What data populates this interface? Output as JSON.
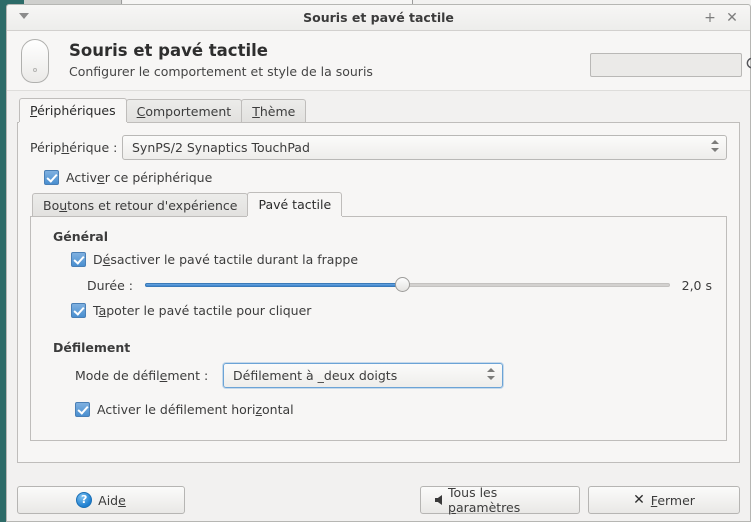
{
  "window": {
    "title": "Souris et pavé tactile",
    "menu_icon": "chevron-down-icon",
    "maximize_label": "+",
    "close_label": "✕"
  },
  "header": {
    "icon": "mouse-icon",
    "title": "Souris et pavé tactile",
    "subtitle": "Configurer le comportement et style de la souris",
    "search": {
      "value": "",
      "placeholder": "",
      "icon": "search-icon"
    }
  },
  "tabs": [
    {
      "label": "Périphériques",
      "mnemonic": "P",
      "active": true
    },
    {
      "label": "Comportement",
      "mnemonic": "C",
      "active": false
    },
    {
      "label": "Thème",
      "mnemonic": "T",
      "active": false
    }
  ],
  "device": {
    "label_pre": "Périp",
    "label_mn": "h",
    "label_post": "érique :",
    "value": "SynPS/2 Synaptics TouchPad",
    "enable_checkbox": {
      "pre": "Activ",
      "mn": "e",
      "post": "r ce périphérique",
      "checked": true
    }
  },
  "inner_tabs": [
    {
      "pre": "Bo",
      "mn": "u",
      "post": "tons et retour d'expérience",
      "active": false
    },
    {
      "pre": "",
      "mn": "",
      "post": "Pavé tactile",
      "active": true
    }
  ],
  "general": {
    "section_title": "Général",
    "disable_while_typing": {
      "pre": "D",
      "mn": "é",
      "post": "sactiver le pavé tactile durant la frappe",
      "checked": true
    },
    "duration": {
      "label": "Durée :",
      "value_text": "2,0 s",
      "value": 2.0,
      "min": 0.0,
      "max": 3.6,
      "percent": 49
    },
    "tap_to_click": {
      "pre": "T",
      "mn": "a",
      "post": "poter le pavé tactile pour cliquer",
      "checked": true
    }
  },
  "scrolling": {
    "section_title": "Défilement",
    "mode_label_pre": "Mode de défil",
    "mode_label_mn": "e",
    "mode_label_post": "ment :",
    "mode_value": "Défilement à _deux doigts",
    "horizontal": {
      "pre": "Activer le défilement hori",
      "mn": "z",
      "post": "ontal",
      "checked": true
    }
  },
  "actions": {
    "help": {
      "pre": "Aid",
      "mn": "e",
      "post": "",
      "icon": "help-icon"
    },
    "all_settings": {
      "pre": "Tous les ",
      "mn": "p",
      "post": "aramètres",
      "icon": "arrow-left-icon"
    },
    "close": {
      "pre": "",
      "mn": "F",
      "post": "ermer",
      "icon": "close-x-icon"
    }
  },
  "colors": {
    "accent_blue": "#4a8fd0",
    "panel_teal": "#2d6b68",
    "window_bg": "#f2f1f0",
    "page_bg": "#f7f6f5"
  }
}
